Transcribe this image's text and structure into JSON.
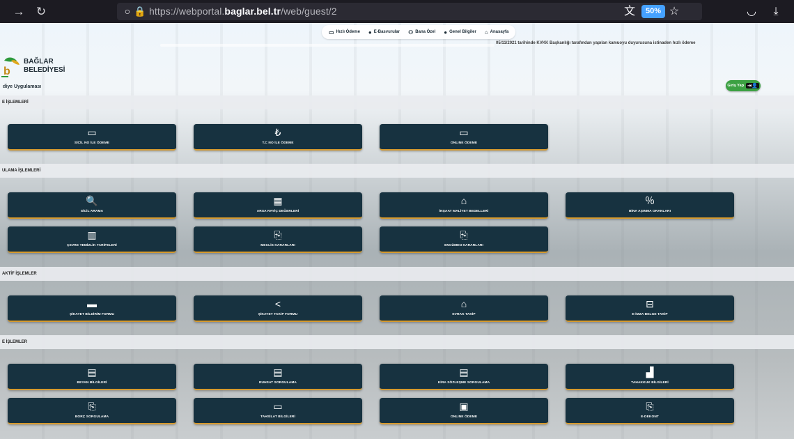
{
  "browser": {
    "url_prefix": "https://webportal.",
    "url_domain": "baglar.bel.tr",
    "url_path": "/web/guest/2",
    "zoom": "50%",
    "icons": [
      "arrow-right-icon",
      "reload-icon",
      "shield-icon",
      "lock-icon",
      "translate-icon",
      "bookmark-star-icon",
      "pocket-icon",
      "download-icon"
    ]
  },
  "top_nav": [
    {
      "label": "Hızlı Ödeme",
      "icon": "card-icon"
    },
    {
      "label": "E-Basvurular",
      "icon": "chat-icon"
    },
    {
      "label": "Bana Özel",
      "icon": "users-icon"
    },
    {
      "label": "Genel Bilgiler",
      "icon": "chat-icon"
    },
    {
      "label": "Anasayfa",
      "icon": "home-icon"
    }
  ],
  "ticker": "05/11/2021 tarihinde KVKK Başkanlığı tarafından yapılan kamuoyu duyurusuna istinaden hızlı ödeme",
  "logo": {
    "line1": "BAĞLAR",
    "line2": "BELEDİYESİ",
    "mark": "b"
  },
  "subtitle": "diye Uygulaması",
  "login": {
    "label": "Giriş Yap"
  },
  "sections": [
    {
      "title": "E İŞLEMLERİ",
      "tiles": [
        {
          "label": "SİCİL NO İLE ÖDEME",
          "icon": "card-icon"
        },
        {
          "label": "T.C NO İLE ÖDEME",
          "icon": "lira-icon"
        },
        {
          "label": "ONLINE ÖDEME",
          "icon": "card-icon"
        }
      ]
    },
    {
      "title": "ULAMA İŞLEMLERİ",
      "tiles": [
        {
          "label": "SİCİL ARAMA",
          "icon": "search-icon"
        },
        {
          "label": "ARSA RAYİÇ DEĞERLERİ",
          "icon": "calculator-icon"
        },
        {
          "label": "İNŞAAT MALİYET BEDELLERİ",
          "icon": "building-icon"
        },
        {
          "label": "BİNA AŞINMA ORANLARI",
          "icon": "percent-doc-icon"
        },
        {
          "label": "ÇEVRE TEMİZLİK TARİFELERİ",
          "icon": "trash-icon"
        },
        {
          "label": "MECLİS KARARLARI",
          "icon": "file-search-icon"
        },
        {
          "label": "ENCÜMEN KARARLARI",
          "icon": "file-search-icon"
        }
      ]
    },
    {
      "title": "AKTİF İŞLEMLER",
      "tiles": [
        {
          "label": "ŞİKAYET BİLDİRİM FORMU",
          "icon": "comments-icon"
        },
        {
          "label": "ŞİKAYET TAKİP FORMU",
          "icon": "share-icon"
        },
        {
          "label": "EVRAK TAKİP",
          "icon": "institution-icon"
        },
        {
          "label": "E-İMZA BELGE TAKİP",
          "icon": "drive-icon"
        }
      ]
    },
    {
      "title": "E İŞLEMLER",
      "tiles": [
        {
          "label": "BEYAN BİLGİLERİ",
          "icon": "clipboard-icon"
        },
        {
          "label": "RUHSAT SORGULAMA",
          "icon": "doc-search-icon"
        },
        {
          "label": "KİRA SÖZLEŞME SORGULAMA",
          "icon": "document-icon"
        },
        {
          "label": "TAHAKKUK BİLGİLERİ",
          "icon": "signal-bars-icon"
        },
        {
          "label": "BORÇ SORGULAMA",
          "icon": "file-gear-icon"
        },
        {
          "label": "TAHSİLAT BİLGİLERİ",
          "icon": "card-coin-icon"
        },
        {
          "label": "ONLINE ÖDEME",
          "icon": "monitor-pay-icon"
        },
        {
          "label": "E-DEKONT",
          "icon": "file-gear-icon"
        }
      ]
    }
  ]
}
